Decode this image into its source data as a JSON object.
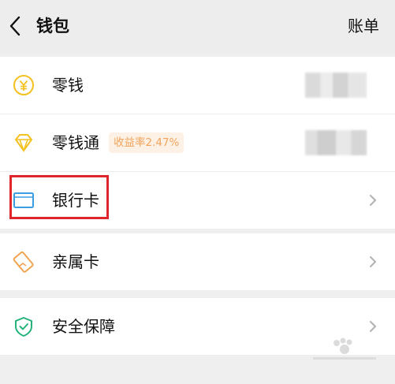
{
  "header": {
    "title": "钱包",
    "bill_label": "账单"
  },
  "items": {
    "change": {
      "label": "零钱"
    },
    "balance_plus": {
      "label": "零钱通",
      "badge": "收益率2.47%"
    },
    "bank_card": {
      "label": "银行卡"
    },
    "family_card": {
      "label": "亲属卡"
    },
    "security": {
      "label": "安全保障"
    }
  },
  "colors": {
    "yellow_icon": "#f4c11f",
    "blue_icon": "#3a9ee0",
    "orange_icon": "#f1a452",
    "green_icon": "#23b27a",
    "highlight_red": "#e0262d",
    "badge_text": "#f2a35a"
  }
}
